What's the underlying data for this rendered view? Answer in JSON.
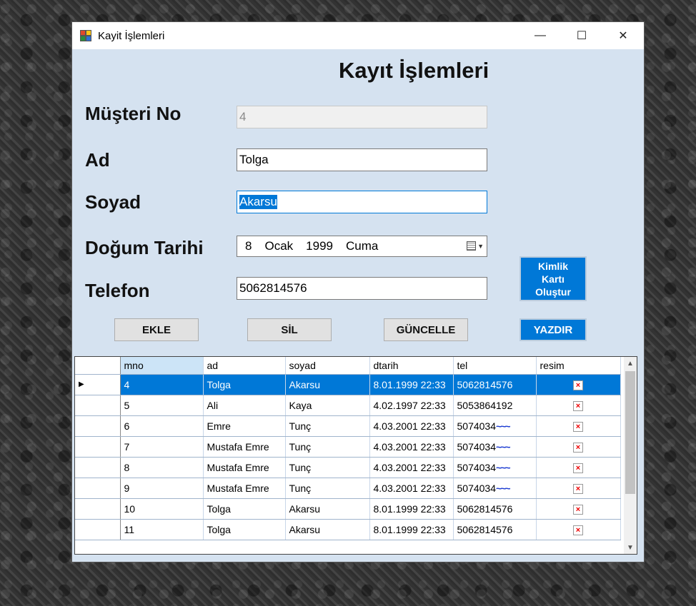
{
  "window": {
    "title": "Kayit İşlemleri"
  },
  "form": {
    "title": "Kayıt İşlemleri",
    "labels": {
      "musteri_no": "Müşteri No",
      "ad": "Ad",
      "soyad": "Soyad",
      "dogum_tarihi": "Doğum Tarihi",
      "telefon": "Telefon"
    },
    "values": {
      "musteri_no": "4",
      "ad": "Tolga",
      "soyad": "Akarsu",
      "telefon": "5062814576"
    },
    "date": {
      "day": "8",
      "month": "Ocak",
      "year": "1999",
      "weekday": "Cuma"
    }
  },
  "buttons": {
    "ekle": "EKLE",
    "sil": "SİL",
    "guncelle": "GÜNCELLE",
    "yazdir": "YAZDIR",
    "kimlik_line1": "Kimlik",
    "kimlik_line2": "Kartı",
    "kimlik_line3": "Oluştur"
  },
  "grid": {
    "columns": [
      "mno",
      "ad",
      "soyad",
      "dtarih",
      "tel",
      "resim"
    ],
    "rows": [
      {
        "mno": "4",
        "ad": "Tolga",
        "soyad": "Akarsu",
        "dtarih": "8.01.1999 22:33",
        "tel": "5062814576",
        "tel_scribble": ""
      },
      {
        "mno": "5",
        "ad": "Ali",
        "soyad": "Kaya",
        "dtarih": "4.02.1997 22:33",
        "tel": "5053864192",
        "tel_scribble": ""
      },
      {
        "mno": "6",
        "ad": "Emre",
        "soyad": "Tunç",
        "dtarih": "4.03.2001 22:33",
        "tel": "5074034",
        "tel_scribble": "~~~"
      },
      {
        "mno": "7",
        "ad": "Mustafa Emre",
        "soyad": "Tunç",
        "dtarih": "4.03.2001 22:33",
        "tel": "5074034",
        "tel_scribble": "~~~"
      },
      {
        "mno": "8",
        "ad": "Mustafa Emre",
        "soyad": "Tunç",
        "dtarih": "4.03.2001 22:33",
        "tel": "5074034",
        "tel_scribble": "~~~"
      },
      {
        "mno": "9",
        "ad": "Mustafa Emre",
        "soyad": "Tunç",
        "dtarih": "4.03.2001 22:33",
        "tel": "5074034",
        "tel_scribble": "~~~"
      },
      {
        "mno": "10",
        "ad": "Tolga",
        "soyad": "Akarsu",
        "dtarih": "8.01.1999 22:33",
        "tel": "5062814576",
        "tel_scribble": ""
      },
      {
        "mno": "11",
        "ad": "Tolga",
        "soyad": "Akarsu",
        "dtarih": "8.01.1999 22:33",
        "tel": "5062814576",
        "tel_scribble": ""
      }
    ],
    "selected_row": 0,
    "current_row_marker": "▶"
  },
  "icons": {
    "broken_image": "×",
    "scroll_up": "▲",
    "scroll_down": "▼",
    "minimize": "—",
    "maximize": "☐",
    "close": "✕"
  },
  "colors": {
    "accent": "#0078d7",
    "form_bg": "#d5e2f0"
  }
}
